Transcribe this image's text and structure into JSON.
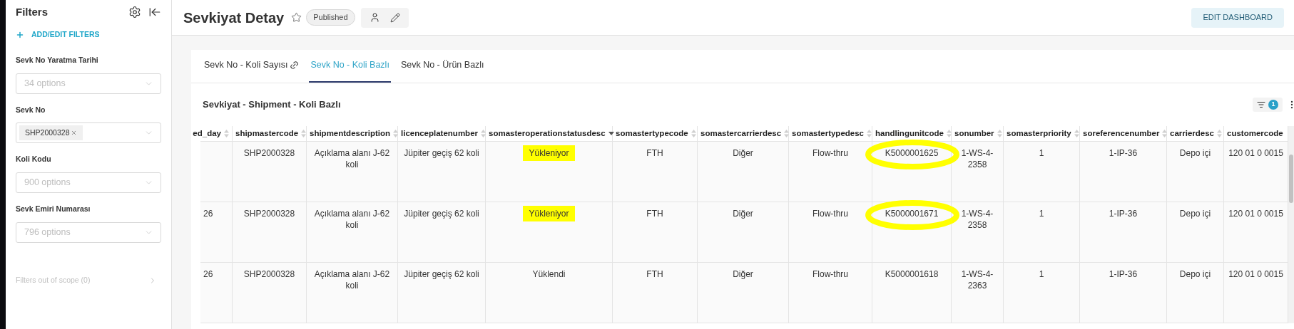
{
  "sidebar": {
    "title": "Filters",
    "add_filters": "ADD/EDIT FILTERS",
    "filters": [
      {
        "label": "Sevk No Yaratma Tarihi",
        "placeholder": "34 options"
      },
      {
        "label": "Sevk No",
        "tags": [
          "SHP2000328"
        ]
      },
      {
        "label": "Koli Kodu",
        "placeholder": "900 options"
      },
      {
        "label": "Sevk Emiri Numarası",
        "placeholder": "796 options"
      }
    ],
    "out_of_scope": "Filters out of scope (0)"
  },
  "header": {
    "title": "Sevkiyat Detay",
    "status": "Published",
    "edit_button": "EDIT DASHBOARD"
  },
  "tabs": [
    {
      "label": "Sevk No - Koli Sayısı",
      "selected": false,
      "linked": true
    },
    {
      "label": "Sevk No - Koli Bazlı",
      "selected": true,
      "linked": false
    },
    {
      "label": "Sevk No - Ürün Bazlı",
      "selected": false,
      "linked": false
    }
  ],
  "chart": {
    "title": "Sevkiyat - Shipment - Koli Bazlı",
    "filter_count": "1"
  },
  "table": {
    "columns": [
      {
        "label": "ed_day",
        "sorted": false
      },
      {
        "label": "shipmastercode",
        "sorted": false
      },
      {
        "label": "shipmentdescription",
        "sorted": false
      },
      {
        "label": "licenceplatenumber",
        "sorted": false
      },
      {
        "label": "somasteroperationstatusdesc",
        "sorted": true
      },
      {
        "label": "somastertypecode",
        "sorted": false
      },
      {
        "label": "somastercarrierdesc",
        "sorted": false
      },
      {
        "label": "somastertypedesc",
        "sorted": false
      },
      {
        "label": "handlingunitcode",
        "sorted": false
      },
      {
        "label": "sonumber",
        "sorted": false
      },
      {
        "label": "somasterpriority",
        "sorted": false
      },
      {
        "label": "soreferencenumber",
        "sorted": false
      },
      {
        "label": "carrierdesc",
        "sorted": false
      },
      {
        "label": "customercode"
      }
    ],
    "rows": [
      {
        "status_highlighted": true,
        "code_circled": true,
        "cells": [
          null,
          "SHP2000328",
          "Açıklama alanı J-62 koli",
          "Jüpiter geçiş 62 koli",
          "Yükleniyor",
          "FTH",
          "Diğer",
          "Flow-thru",
          "K5000001625",
          "1-WS-4-2358",
          "1",
          "1-IP-36",
          "Depo içi",
          "120 01 0 0015"
        ]
      },
      {
        "status_highlighted": true,
        "code_circled": true,
        "cells": [
          "26",
          "SHP2000328",
          "Açıklama alanı J-62 koli",
          "Jüpiter geçiş 62 koli",
          "Yükleniyor",
          "FTH",
          "Diğer",
          "Flow-thru",
          "K5000001671",
          "1-WS-4-2358",
          "1",
          "1-IP-36",
          "Depo içi",
          "120 01 0 0015"
        ]
      },
      {
        "status_highlighted": false,
        "code_circled": false,
        "cells": [
          "26",
          "SHP2000328",
          "Açıklama alanı J-62 koli",
          "Jüpiter geçiş 62 koli",
          "Yüklendi",
          "FTH",
          "Diğer",
          "Flow-thru",
          "K5000001618",
          "1-WS-4-2363",
          "1",
          "1-IP-36",
          "Depo içi",
          "120 01 0 0015"
        ]
      }
    ]
  }
}
